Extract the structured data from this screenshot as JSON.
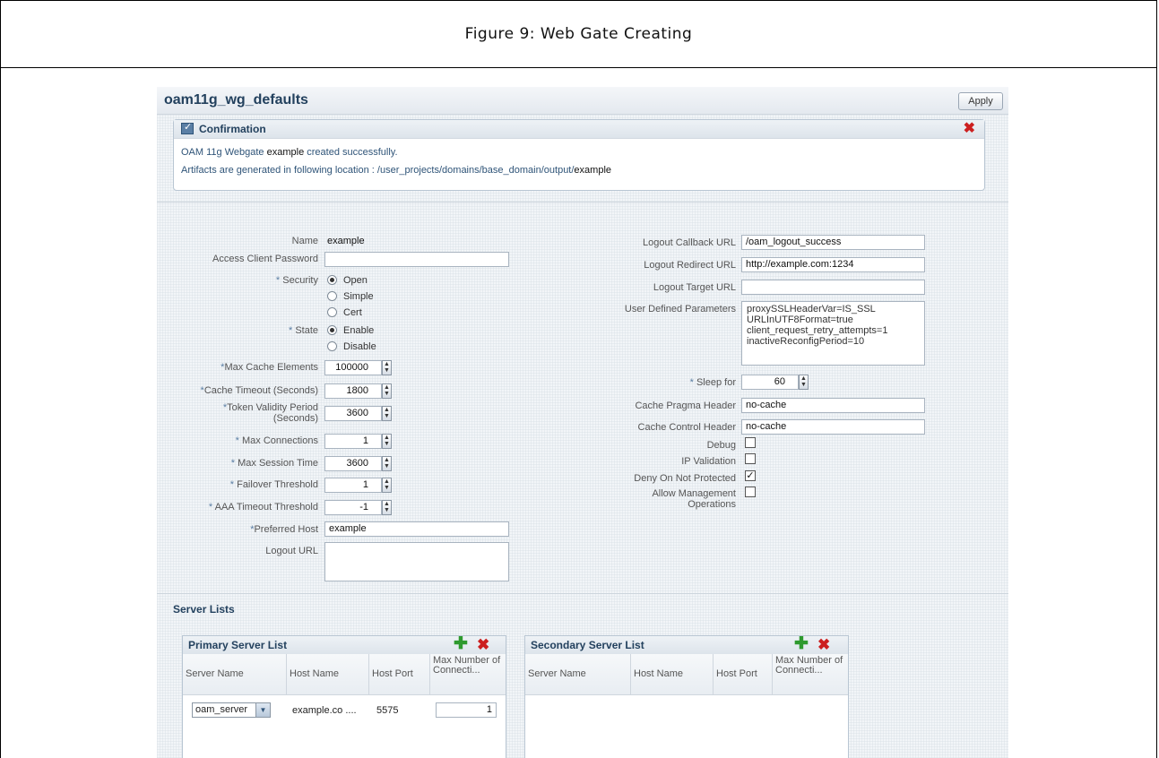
{
  "caption": "Figure 9: Web Gate Creating",
  "header": {
    "title": "oam11g_wg_defaults",
    "apply_label": "Apply"
  },
  "confirmation": {
    "title": "Confirmation",
    "line1_prefix": "OAM 11g Webgate",
    "line1_name": "example",
    "line1_suffix": "created successfully.",
    "line2_prefix": "Artifacts are generated in following location : /user_projects/domains/base_domain/output/",
    "line2_name": "example"
  },
  "left": {
    "name_label": "Name",
    "name_value": "example",
    "password_label": "Access Client Password",
    "security_label": "Security",
    "security_options": [
      "Open",
      "Simple",
      "Cert"
    ],
    "security_selected": "Open",
    "state_label": "State",
    "state_options": [
      "Enable",
      "Disable"
    ],
    "state_selected": "Enable",
    "max_cache_label": "Max Cache Elements",
    "max_cache_value": "100000",
    "cache_timeout_label": "Cache Timeout (Seconds)",
    "cache_timeout_value": "1800",
    "token_validity_label_1": "Token Validity Period",
    "token_validity_label_2": "(Seconds)",
    "token_validity_value": "3600",
    "max_conn_label": "Max Connections",
    "max_conn_value": "1",
    "max_session_label": "Max Session Time",
    "max_session_value": "3600",
    "failover_label": "Failover Threshold",
    "failover_value": "1",
    "aaa_timeout_label": "AAA Timeout Threshold",
    "aaa_timeout_value": "-1",
    "preferred_host_label": "Preferred Host",
    "preferred_host_value": "example",
    "logout_url_label": "Logout URL",
    "required_mark": "*"
  },
  "right": {
    "logout_callback_label": "Logout Callback URL",
    "logout_callback_value": "/oam_logout_success",
    "logout_redirect_label": "Logout Redirect URL",
    "logout_redirect_value": "http://example.com:1234",
    "logout_target_label": "Logout Target URL",
    "user_params_label": "User Defined Parameters",
    "user_params_lines": [
      "proxySSLHeaderVar=IS_SSL",
      "URLInUTF8Format=true",
      "client_request_retry_attempts=1",
      "inactiveReconfigPeriod=10"
    ],
    "sleep_label": "Sleep for",
    "sleep_value": "60",
    "cache_pragma_label": "Cache Pragma Header",
    "cache_pragma_value": "no-cache",
    "cache_control_label": "Cache Control Header",
    "cache_control_value": "no-cache",
    "debug_label": "Debug",
    "debug_checked": false,
    "ip_validation_label": "IP Validation",
    "ip_validation_checked": false,
    "deny_label": "Deny On Not Protected",
    "deny_checked": true,
    "allow_mgmt_label_1": "Allow Management",
    "allow_mgmt_label_2": "Operations",
    "allow_mgmt_checked": false
  },
  "server_lists": {
    "title": "Server Lists",
    "primary": {
      "title": "Primary Server List",
      "columns": [
        "Server Name",
        "Host Name",
        "Host Port",
        "Max Number of Connecti..."
      ],
      "rows": [
        {
          "server": "oam_server",
          "host": "example.co",
          "ellipsis": "....",
          "port": "5575",
          "max": "1"
        }
      ]
    },
    "secondary": {
      "title": "Secondary Server List",
      "columns": [
        "Server Name",
        "Host Name",
        "Host Port",
        "Max Number of Connecti..."
      ]
    }
  },
  "colors": {
    "title_blue": "#23415e",
    "add_green": "#2e9a2e",
    "delete_red": "#cc1f1f"
  }
}
